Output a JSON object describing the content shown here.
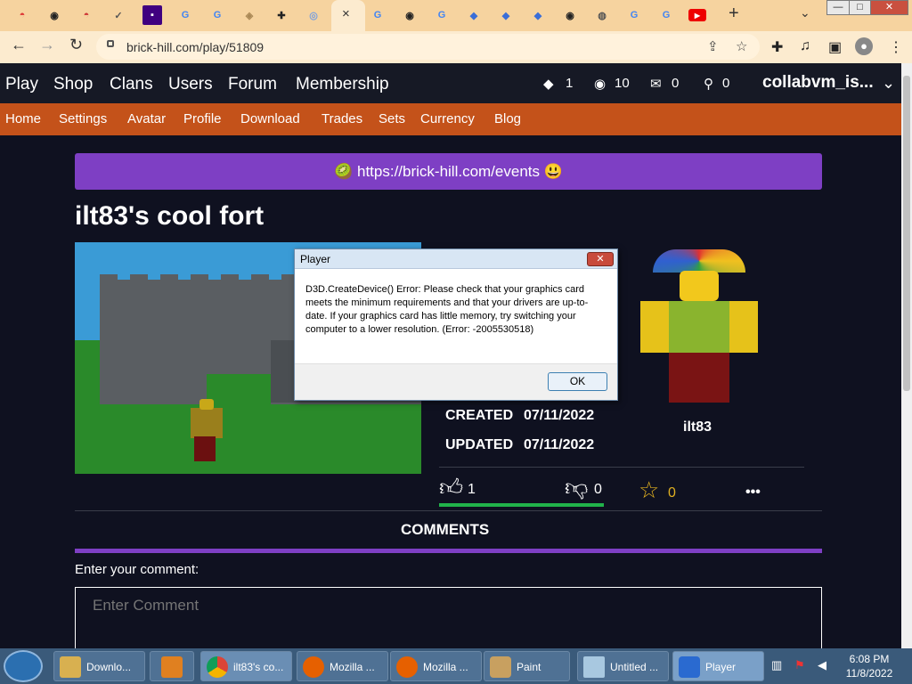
{
  "browser": {
    "url": "brick-hill.com/play/51809",
    "tab_close": "×",
    "new_tab": "+",
    "win_min": "—",
    "win_max": "□",
    "win_close": "✕"
  },
  "site": {
    "nav": [
      "Play",
      "Shop",
      "Clans",
      "Users",
      "Forum",
      "Membership"
    ],
    "stats": {
      "bricks": "1",
      "bits": "10",
      "messages": "0",
      "friends": "0"
    },
    "username": "collabvm_is...",
    "subnav": [
      "Home",
      "Settings",
      "Avatar",
      "Profile",
      "Download",
      "Trades",
      "Sets",
      "Currency",
      "Blog"
    ]
  },
  "page": {
    "banner": "🥝 https://brick-hill.com/events 😃",
    "title": "ilt83's cool fort",
    "created_label": "CREATED",
    "created_value": "07/11/2022",
    "updated_label": "UPDATED",
    "updated_value": "07/11/2022",
    "creator": "ilt83",
    "likes": "1",
    "dislikes": "0",
    "favorites": "0",
    "more": "•••",
    "comments_heading": "COMMENTS",
    "enter_label": "Enter your comment:",
    "comment_placeholder": "Enter Comment"
  },
  "dialog": {
    "title": "Player",
    "message": "D3D.CreateDevice() Error: Please check that your graphics card meets the minimum requirements and that your drivers are up-to-date. If your graphics card has little memory, try switching your computer to a lower resolution. (Error: -2005530518)",
    "ok": "OK",
    "close": "✕"
  },
  "taskbar": {
    "items": [
      "Downlo...",
      "",
      "ilt83's co...",
      "Mozilla ...",
      "Mozilla ...",
      "Paint",
      "Untitled ...",
      "Player"
    ],
    "time": "6:08 PM",
    "date": "11/8/2022"
  },
  "colors": {
    "accent_purple": "#7e3fc4",
    "subnav_orange": "#c4521a",
    "page_bg": "#0f1120",
    "tabstrip": "#f6d39f"
  }
}
